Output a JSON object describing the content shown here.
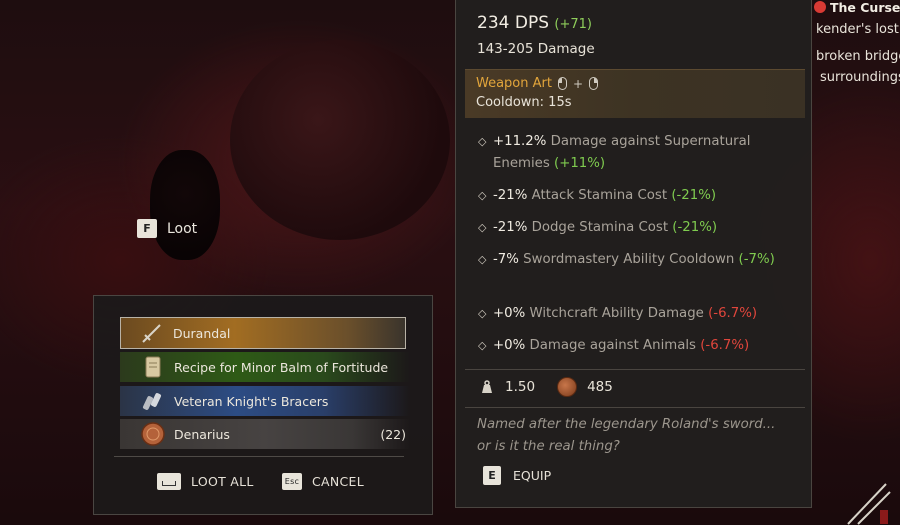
{
  "loot_prompt": {
    "key": "F",
    "label": "Loot"
  },
  "loot_window": {
    "items": [
      {
        "name": "Durandal",
        "icon": "sword-icon",
        "rarity_color": "#a26d22",
        "selected": true,
        "quantity": ""
      },
      {
        "name": "Recipe for Minor Balm of Fortitude",
        "icon": "scroll-icon",
        "rarity_color": "#2e5a16",
        "selected": false,
        "quantity": ""
      },
      {
        "name": "Veteran Knight's Bracers",
        "icon": "bracers-icon",
        "rarity_color": "#2c4c84",
        "selected": false,
        "quantity": ""
      },
      {
        "name": "Denarius",
        "icon": "coin-icon",
        "rarity_color": "#474342",
        "selected": false,
        "quantity": "(22)"
      }
    ],
    "actions": {
      "loot_all": {
        "key_icon": "space-key-icon",
        "label": "LOOT ALL"
      },
      "cancel": {
        "key": "Esc",
        "label": "CANCEL"
      }
    }
  },
  "tooltip": {
    "dps_value": "234 DPS",
    "dps_delta": "(+71)",
    "damage_range": "143-205 Damage",
    "weapon_art": {
      "title": "Weapon Art",
      "plus": "+",
      "cooldown": "Cooldown: 15s"
    },
    "stats": [
      {
        "value": "+11.2%",
        "label": " Damage against Supernatural Enemies",
        "compare": "(+11%)",
        "compare_type": "pos"
      },
      {
        "value": "-21%",
        "label": " Attack Stamina Cost",
        "compare": "(-21%)",
        "compare_type": "pos"
      },
      {
        "value": "-21%",
        "label": " Dodge Stamina Cost",
        "compare": "(-21%)",
        "compare_type": "pos"
      },
      {
        "value": "-7%",
        "label": " Swordmastery Ability Cooldown",
        "compare": "(-7%)",
        "compare_type": "pos"
      },
      {
        "value": "+0%",
        "label": " Witchcraft Ability Damage",
        "compare": "(-6.7%)",
        "compare_type": "neg"
      },
      {
        "value": "+0%",
        "label": " Damage against Animals",
        "compare": "(-6.7%)",
        "compare_type": "neg"
      }
    ],
    "weight": "1.50",
    "price": "485",
    "lore_line1": "Named after the legendary Roland's sword...",
    "lore_line2": "or is it the real thing?",
    "equip": {
      "key": "E",
      "label": "EQUIP"
    }
  },
  "quest": {
    "title": "The Cursed",
    "line1": "kender's lost t",
    "line2": "broken bridge",
    "line3": "surroundings"
  },
  "colors": {
    "positive": "#7fcb4f",
    "negative": "#e0463c",
    "weapon_art": "#e2a53b"
  }
}
